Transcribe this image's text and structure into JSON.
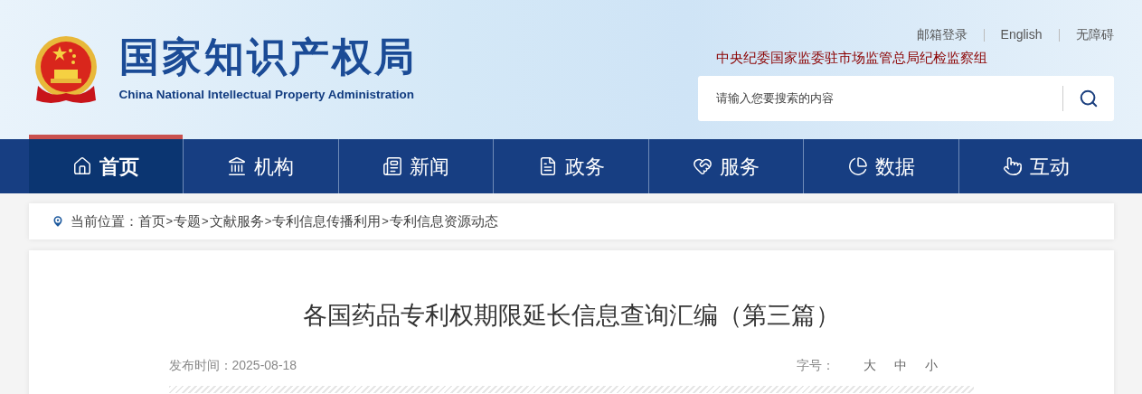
{
  "header": {
    "site_title": "国家知识产权局",
    "site_subtitle": "China National Intellectual Property Administration",
    "top_links": [
      "邮箱登录",
      "English",
      "无障碍"
    ],
    "notice": "中央纪委国家监委驻市场监管总局纪检监察组",
    "search": {
      "placeholder": "请输入您要搜索的内容"
    }
  },
  "nav": [
    {
      "label": "首页",
      "selected": true
    },
    {
      "label": "机构",
      "selected": false
    },
    {
      "label": "新闻",
      "selected": false
    },
    {
      "label": "政务",
      "selected": false
    },
    {
      "label": "服务",
      "selected": false
    },
    {
      "label": "数据",
      "selected": false
    },
    {
      "label": "互动",
      "selected": false
    }
  ],
  "breadcrumb": {
    "label": "当前位置：",
    "separator": ">",
    "items": [
      "首页",
      "专题",
      "文献服务",
      "专利信息传播利用",
      "专利信息资源动态"
    ]
  },
  "article": {
    "title": "各国药品专利权期限延长信息查询汇编（第三篇）",
    "date": "发布时间：2025-08-18",
    "font_size_label": "字号：",
    "font_sizes": [
      "大",
      "中",
      "小"
    ]
  }
}
